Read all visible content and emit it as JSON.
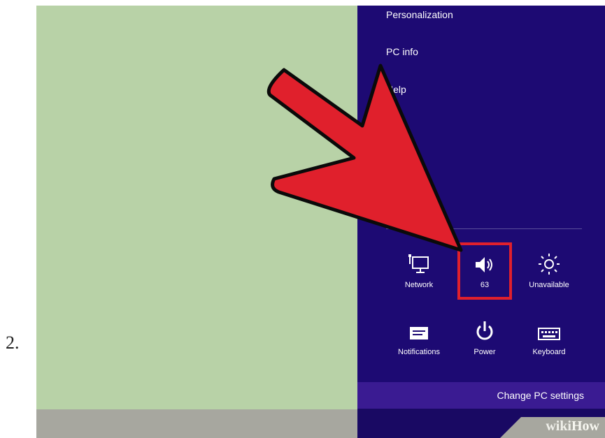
{
  "step_number": "2.",
  "charms": {
    "menu": [
      "Personalization",
      "PC info",
      "Help"
    ],
    "tiles": [
      {
        "label": "Network",
        "icon": "network-icon"
      },
      {
        "label": "63",
        "icon": "volume-icon"
      },
      {
        "label": "Unavailable",
        "icon": "brightness-icon"
      },
      {
        "label": "Notifications",
        "icon": "notifications-icon"
      },
      {
        "label": "Power",
        "icon": "power-icon"
      },
      {
        "label": "Keyboard",
        "icon": "keyboard-icon"
      }
    ],
    "change_settings": "Change PC settings"
  },
  "watermark": {
    "prefix": "wiki",
    "suffix": "How"
  },
  "colors": {
    "panel": "#1d0a73",
    "accent_arrow": "#e0202c",
    "background": "#b8d2a7"
  }
}
